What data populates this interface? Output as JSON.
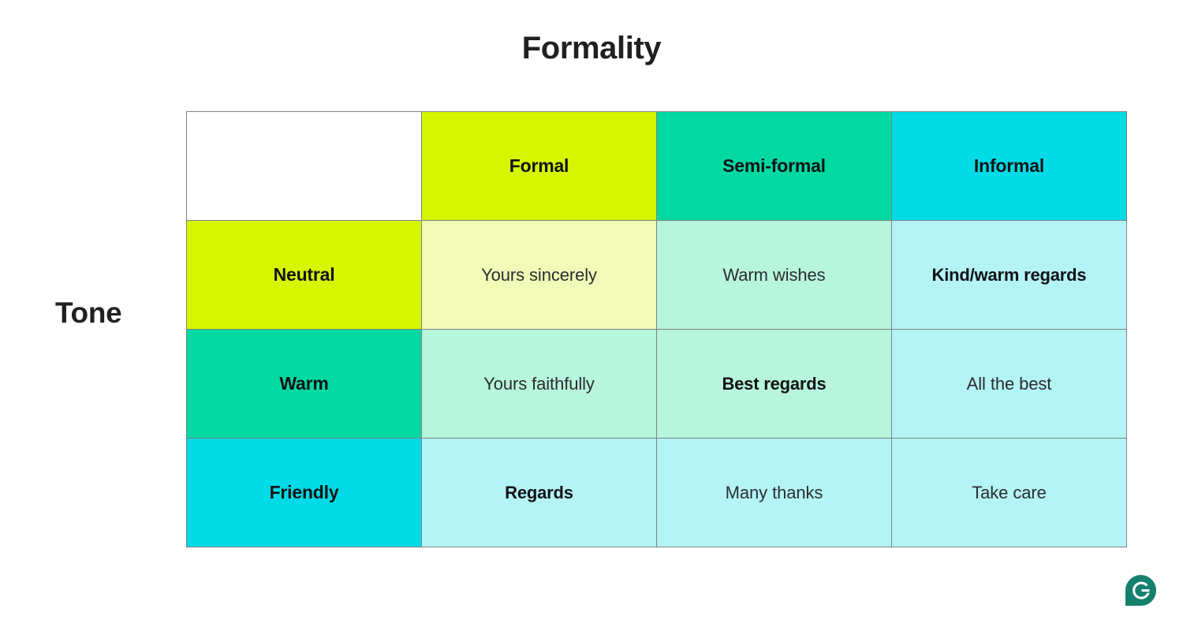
{
  "slide": {
    "title": "Formality",
    "row_axis_label": "Tone",
    "background_color": "#ffffff",
    "text_color": "#1f2022"
  },
  "brand": {
    "logo_icon": "grammarly-logo-icon",
    "logo_color": "#15806E",
    "logo_letter": "G"
  },
  "palette": {
    "formal_strong": "#D6F500",
    "semiformal_strong": "#00D9A2",
    "informal_strong": "#00DBE5",
    "formal_tint": "#F1FAB6",
    "semiformal_tint": "#B7F5DC",
    "informal_tint": "#B4F4F6",
    "border": "#7d8285",
    "corner": "#ffffff"
  },
  "chart_data": {
    "type": "table",
    "title": "Formality",
    "xlabel": "Formality",
    "ylabel": "Tone",
    "corner_label": "",
    "columns": [
      "Formal",
      "Semi-formal",
      "Informal"
    ],
    "rows": [
      "Neutral",
      "Warm",
      "Friendly"
    ],
    "cells": [
      [
        "Yours sincerely",
        "Warm wishes",
        "Kind/warm regards"
      ],
      [
        "Yours faithfully",
        "Best regards",
        "All the best"
      ],
      [
        "Regards",
        "Many thanks",
        "Take care"
      ]
    ],
    "emphasis": [
      [
        false,
        false,
        true
      ],
      [
        false,
        true,
        false
      ],
      [
        true,
        false,
        false
      ]
    ],
    "column_colors": [
      "#D6F500",
      "#00D9A2",
      "#00DBE5"
    ],
    "row_colors": [
      "#D6F500",
      "#00D9A2",
      "#00DBE5"
    ],
    "cell_colors": [
      [
        "#F1FAB6",
        "#B7F5DC",
        "#B4F4F6"
      ],
      [
        "#B7F5DC",
        "#B7F5DC",
        "#B4F4F6"
      ],
      [
        "#B4F4F6",
        "#B4F4F6",
        "#B4F4F6"
      ]
    ]
  }
}
